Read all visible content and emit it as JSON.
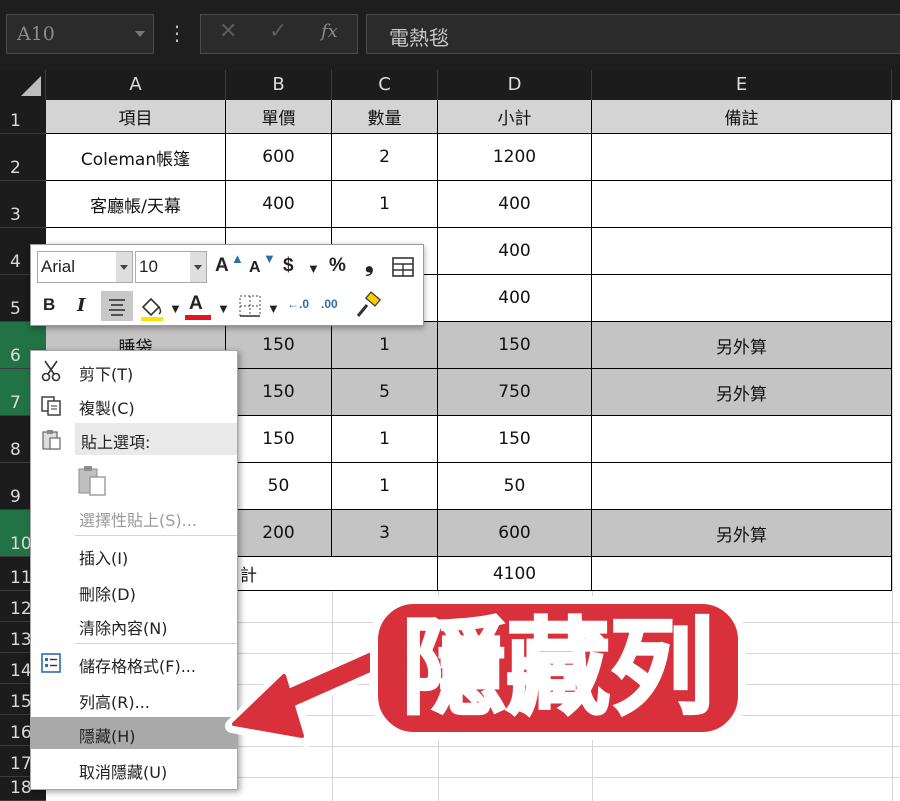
{
  "name_box": "A10",
  "formula": {
    "cancel_icon": "✕",
    "enter_icon": "✓",
    "fx_label": "fx",
    "content": "電熱毯"
  },
  "columns": [
    "A",
    "B",
    "C",
    "D",
    "E"
  ],
  "rows": [
    "1",
    "2",
    "3",
    "4",
    "5",
    "6",
    "7",
    "8",
    "9",
    "10",
    "11",
    "12",
    "13",
    "14",
    "15",
    "16",
    "17",
    "18"
  ],
  "table": {
    "headers": [
      "項目",
      "單價",
      "數量",
      "小計",
      "備註"
    ],
    "r2": [
      "Coleman帳篷",
      "600",
      "2",
      "1200",
      ""
    ],
    "r3": [
      "客廳帳/天幕",
      "400",
      "1",
      "400",
      ""
    ],
    "r4d": "400",
    "r5d": "400",
    "r6": [
      "睡袋",
      "150",
      "1",
      "150",
      "另外算"
    ],
    "r7": [
      "150",
      "5",
      "750",
      "另外算"
    ],
    "r8": [
      "150",
      "1",
      "150",
      ""
    ],
    "r9": [
      "50",
      "1",
      "50",
      ""
    ],
    "r10": [
      "200",
      "3",
      "600",
      "另外算"
    ],
    "r11_label": "計",
    "r11_total": "4100"
  },
  "mini_toolbar": {
    "font": "Arial",
    "size": "10",
    "grow_font": "A",
    "shrink_font": "A",
    "currency": "$",
    "percent": "%",
    "comma": "❟",
    "bold": "B",
    "italic": "I",
    "font_color_letter": "A",
    "inc_decimal": "←.0",
    "dec_decimal": ".00",
    "accent": "#e81123"
  },
  "context_menu": {
    "cut": "剪下(T)",
    "copy": "複製(C)",
    "paste_options": "貼上選項:",
    "paste_special": "選擇性貼上(S)...",
    "insert": "插入(I)",
    "delete": "刪除(D)",
    "clear": "清除內容(N)",
    "format_cells": "儲存格格式(F)...",
    "row_height": "列高(R)...",
    "hide": "隱藏(H)",
    "unhide": "取消隱藏(U)"
  },
  "callout": {
    "text": "隱藏列",
    "color": "#d9313c"
  }
}
